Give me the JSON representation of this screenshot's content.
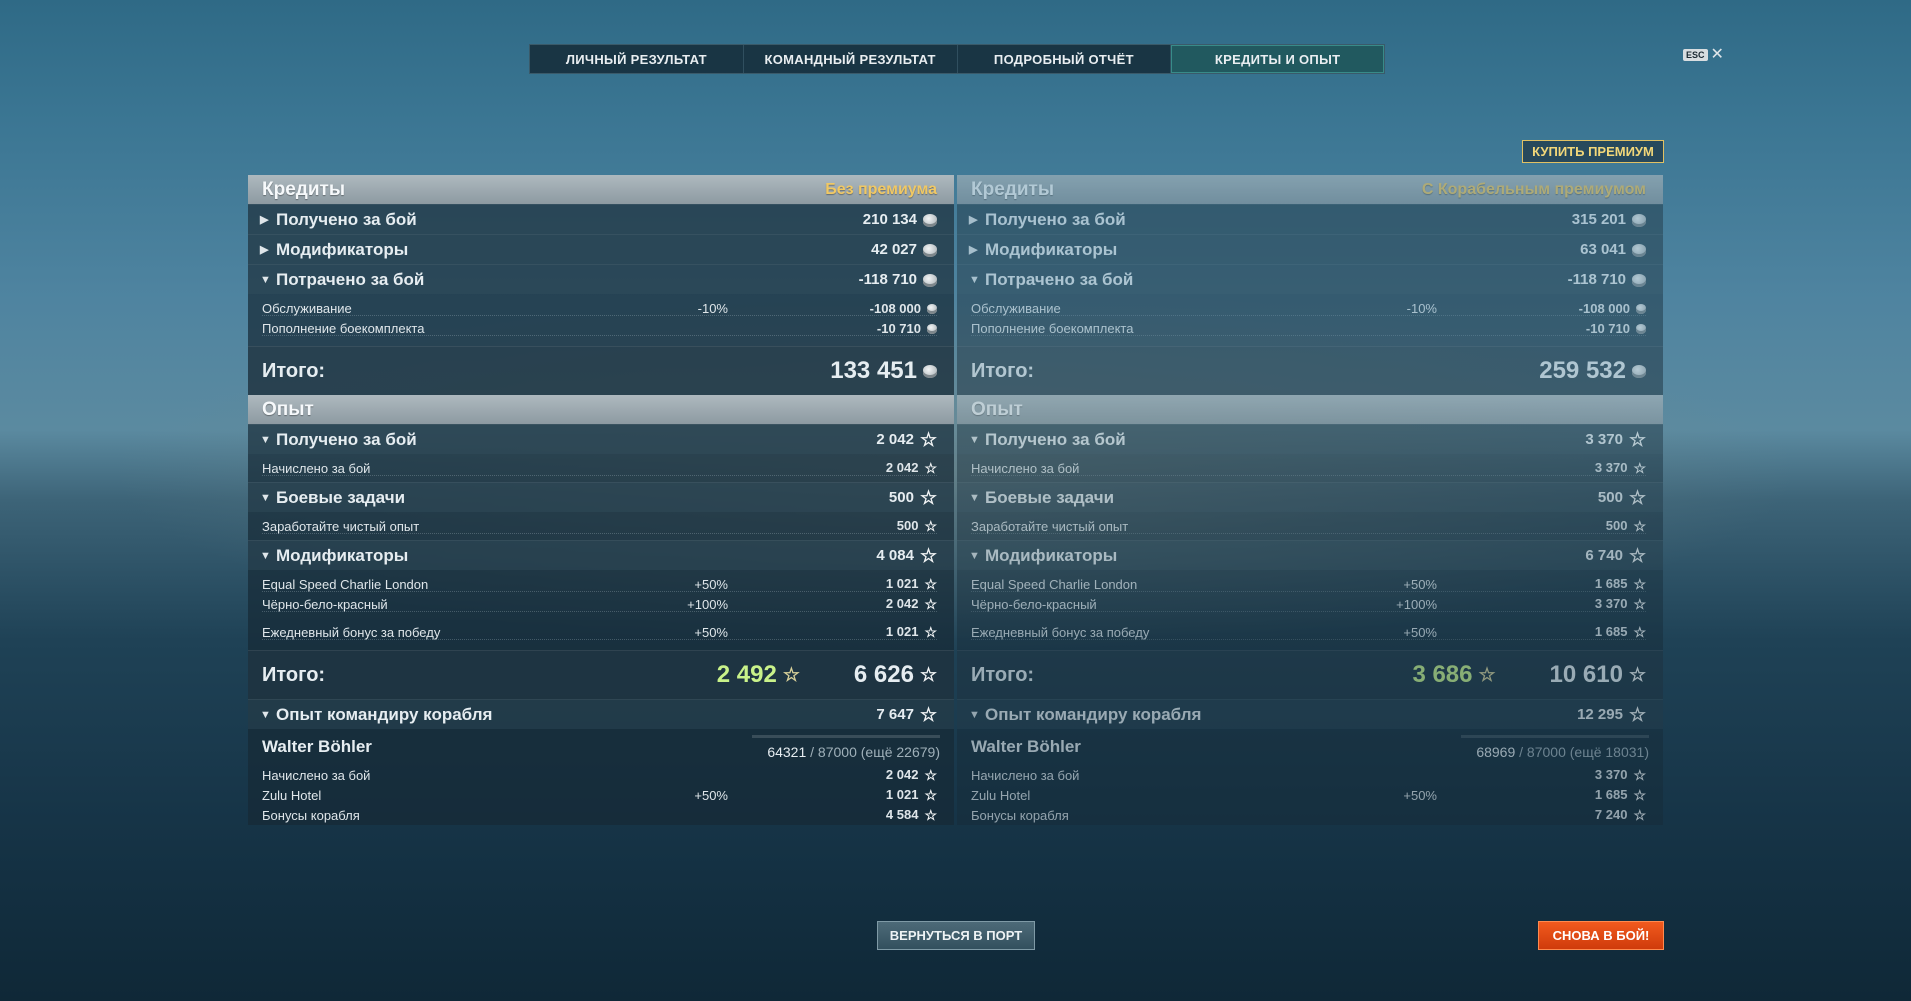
{
  "tabs": [
    "ЛИЧНЫЙ РЕЗУЛЬТАТ",
    "КОМАНДНЫЙ РЕЗУЛЬТАТ",
    "ПОДРОБНЫЙ ОТЧЁТ",
    "КРЕДИТЫ И ОПЫТ"
  ],
  "active_tab": 3,
  "esc_key": "ESC",
  "close_glyph": "✕",
  "buy_premium": "КУПИТЬ ПРЕМИУМ",
  "left": {
    "credits_title": "Кредиты",
    "premium_label": "Без премиума",
    "received": {
      "label": "Получено за бой",
      "value": "210 134"
    },
    "modifiers": {
      "label": "Модификаторы",
      "value": "42 027"
    },
    "spent": {
      "label": "Потрачено за бой",
      "value": "-118 710"
    },
    "service": {
      "label": "Обслуживание",
      "pct": "-10%",
      "value": "-108 000"
    },
    "ammo": {
      "label": "Пополнение боекомплекта",
      "value": "-10 710"
    },
    "credits_total": {
      "label": "Итого:",
      "value": "133 451"
    },
    "xp_title": "Опыт",
    "xp_received": {
      "label": "Получено за бой",
      "value": "2 042"
    },
    "xp_accrued": {
      "label": "Начислено за бой",
      "value": "2 042"
    },
    "combat_missions": {
      "label": "Боевые задачи",
      "value": "500"
    },
    "clean_xp": {
      "label": "Заработайте чистый опыт",
      "value": "500"
    },
    "xp_modifiers": {
      "label": "Модификаторы",
      "value": "4 084"
    },
    "mod1": {
      "label": "Equal Speed Charlie London",
      "pct": "+50%",
      "value": "1 021"
    },
    "mod2": {
      "label": "Чёрно-бело-красный",
      "pct": "+100%",
      "value": "2 042"
    },
    "mod3": {
      "label": "Ежедневный бонус за победу",
      "pct": "+50%",
      "value": "1 021"
    },
    "xp_total": {
      "label": "Итого:",
      "free": "2 492",
      "value": "6 626"
    },
    "commander_xp": {
      "label": "Опыт командиру корабля",
      "value": "7 647"
    },
    "commander": {
      "name": "Walter Böhler",
      "xp": "64321",
      "xp_rest": "/ 87000 (ещё 22679)",
      "progress": 0.739
    },
    "cmd_accrued": {
      "label": "Начислено за бой",
      "value": "2 042"
    },
    "cmd_zulu": {
      "label": "Zulu Hotel",
      "pct": "+50%",
      "value": "1 021"
    },
    "cmd_ship_bonus": {
      "label": "Бонусы корабля",
      "value": "4 584"
    }
  },
  "right": {
    "credits_title": "Кредиты",
    "premium_label": "С Корабельным премиумом",
    "received": {
      "label": "Получено за бой",
      "value": "315 201"
    },
    "modifiers": {
      "label": "Модификаторы",
      "value": "63 041"
    },
    "spent": {
      "label": "Потрачено за бой",
      "value": "-118 710"
    },
    "service": {
      "label": "Обслуживание",
      "pct": "-10%",
      "value": "-108 000"
    },
    "ammo": {
      "label": "Пополнение боекомплекта",
      "value": "-10 710"
    },
    "credits_total": {
      "label": "Итого:",
      "value": "259 532"
    },
    "xp_title": "Опыт",
    "xp_received": {
      "label": "Получено за бой",
      "value": "3 370"
    },
    "xp_accrued": {
      "label": "Начислено за бой",
      "value": "3 370"
    },
    "combat_missions": {
      "label": "Боевые задачи",
      "value": "500"
    },
    "clean_xp": {
      "label": "Заработайте чистый опыт",
      "value": "500"
    },
    "xp_modifiers": {
      "label": "Модификаторы",
      "value": "6 740"
    },
    "mod1": {
      "label": "Equal Speed Charlie London",
      "pct": "+50%",
      "value": "1 685"
    },
    "mod2": {
      "label": "Чёрно-бело-красный",
      "pct": "+100%",
      "value": "3 370"
    },
    "mod3": {
      "label": "Ежедневный бонус за победу",
      "pct": "+50%",
      "value": "1 685"
    },
    "xp_total": {
      "label": "Итого:",
      "free": "3 686",
      "value": "10 610"
    },
    "commander_xp": {
      "label": "Опыт командиру корабля",
      "value": "12 295"
    },
    "commander": {
      "name": "Walter Böhler",
      "xp": "68969",
      "xp_rest": "/ 87000 (ещё 18031)",
      "progress": 0.793
    },
    "cmd_accrued": {
      "label": "Начислено за бой",
      "value": "3 370"
    },
    "cmd_zulu": {
      "label": "Zulu Hotel",
      "pct": "+50%",
      "value": "1 685"
    },
    "cmd_ship_bonus": {
      "label": "Бонусы корабля",
      "value": "7 240"
    }
  },
  "btn_port": "ВЕРНУТЬСЯ В ПОРТ",
  "btn_battle": "СНОВА В БОЙ!",
  "icons": {
    "credits": "credits-coin-icon",
    "xp": "xp-star-icon",
    "free_xp": "free-xp-star-icon"
  }
}
